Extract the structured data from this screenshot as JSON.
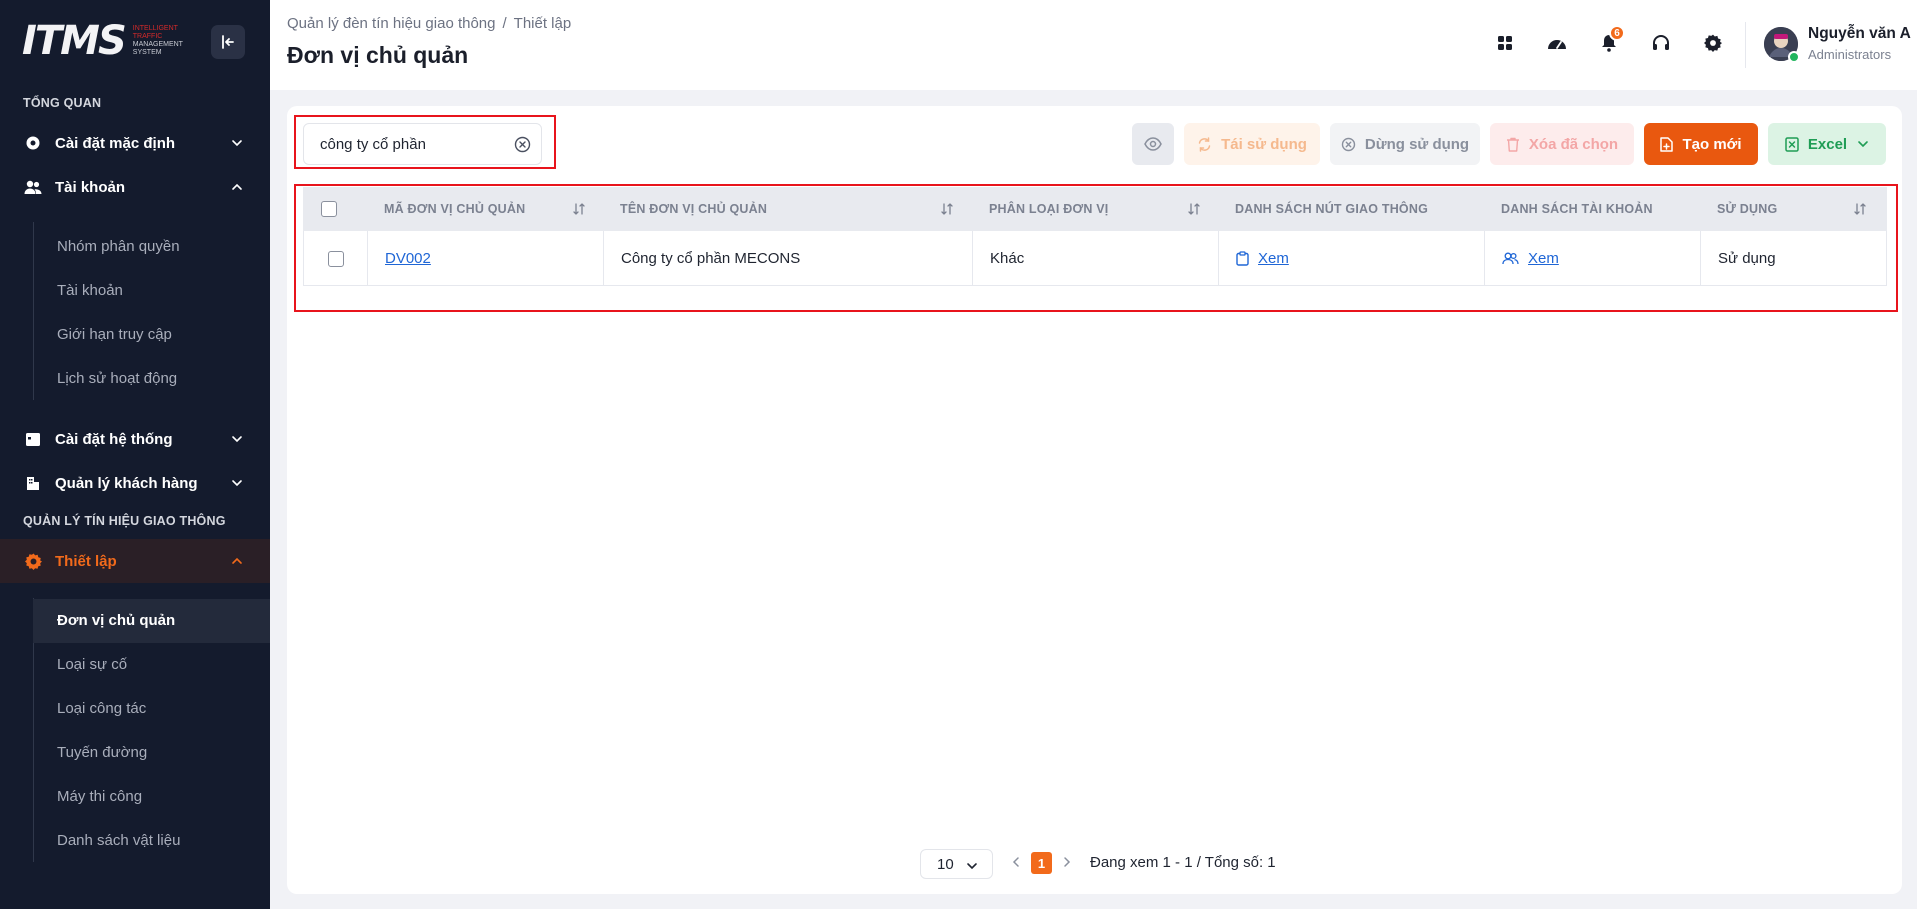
{
  "logo": {
    "text": "ITMS",
    "sub_line1": "INTELLIGENT",
    "sub_line2": "TRAFFIC",
    "sub_line3": "MANAGEMENT",
    "sub_line4": "SYSTEM"
  },
  "sidebar": {
    "section_overview": "TỔNG QUAN",
    "default_settings": "Cài đặt mặc định",
    "account": "Tài khoản",
    "account_items": [
      "Nhóm phân quyền",
      "Tài khoản",
      "Giới hạn truy cập",
      "Lịch sử hoạt động"
    ],
    "system_settings": "Cài đặt hệ thống",
    "customer_mgmt": "Quản lý khách hàng",
    "section_traffic": "QUẢN LÝ TÍN HIỆU GIAO THÔNG",
    "setup": "Thiết lập",
    "setup_items": [
      "Đơn vị chủ quản",
      "Loại sự cố",
      "Loại công tác",
      "Tuyến đường",
      "Máy thi công",
      "Danh sách vật liệu"
    ]
  },
  "header": {
    "breadcrumb": [
      "Quản lý đèn tín hiệu giao thông",
      "Thiết lập"
    ],
    "title": "Đơn vị chủ quản",
    "notification_count": "6",
    "user_name": "Nguyễn văn A",
    "user_role": "Administrators"
  },
  "toolbar": {
    "search_value": "công ty cổ phần",
    "reuse": "Tái sử dụng",
    "stop": "Dừng sử dụng",
    "delete_selected": "Xóa đã chọn",
    "create": "Tạo mới",
    "excel": "Excel"
  },
  "table": {
    "headers": [
      "MÃ ĐƠN VỊ CHỦ QUẢN",
      "TÊN ĐƠN VỊ CHỦ QUẢN",
      "PHÂN LOẠI ĐƠN VỊ",
      "DANH SÁCH NÚT GIAO THÔNG",
      "DANH SÁCH TÀI KHOẢN",
      "SỬ DỤNG"
    ],
    "rows": [
      {
        "code": "DV002",
        "name": "Công ty cổ phần MECONS",
        "type": "Khác",
        "nodes": "Xem",
        "accounts": "Xem",
        "status": "Sử dụng"
      }
    ]
  },
  "pagination": {
    "page_size": "10",
    "current_page": "1",
    "info": "Đang xem 1 - 1 / Tổng số: 1"
  },
  "colors": {
    "accent": "#f26a1b",
    "sidebar_bg": "#141b2d",
    "highlight": "#e8141c",
    "excel": "#1f9d55",
    "link": "#1f66d6"
  }
}
